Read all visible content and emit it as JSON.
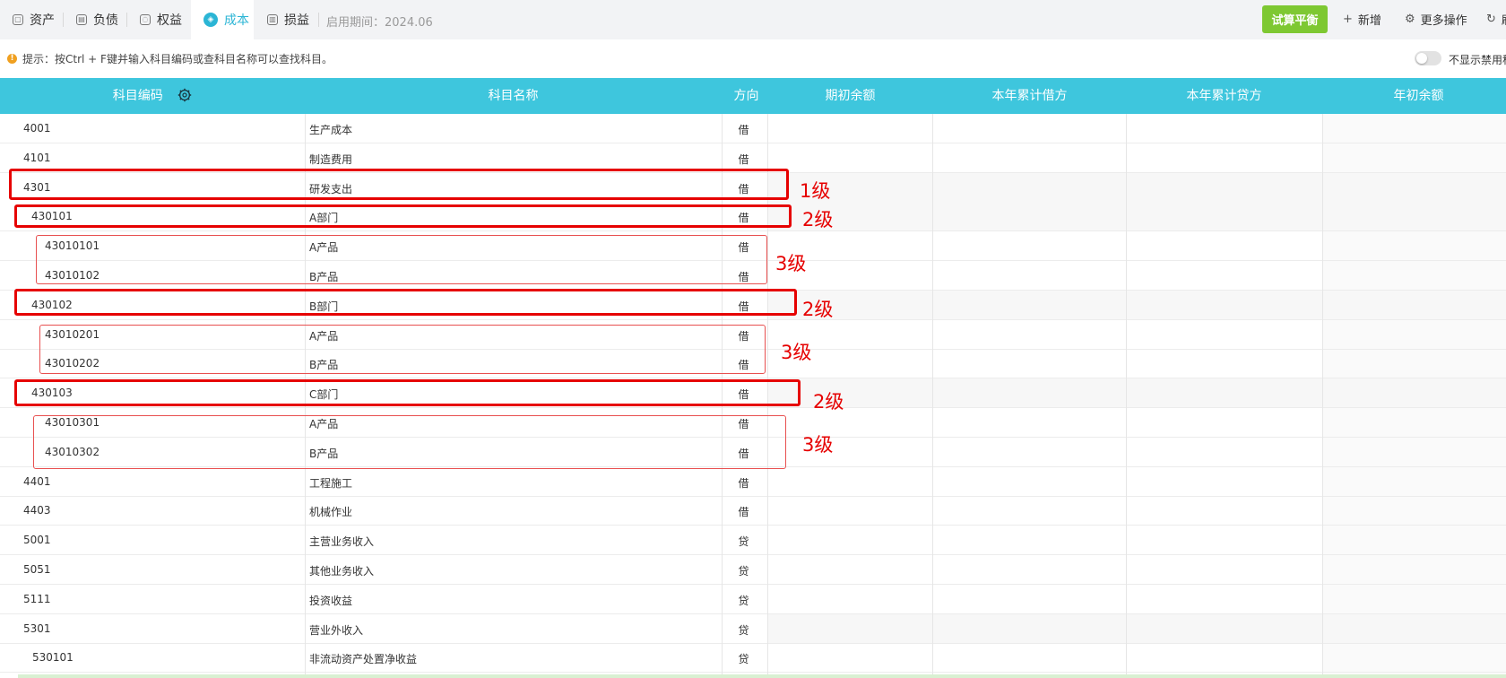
{
  "tabs": [
    {
      "label": "资产",
      "icon": "asset-icon",
      "active": false
    },
    {
      "label": "负债",
      "icon": "liability-icon",
      "active": false
    },
    {
      "label": "权益",
      "icon": "equity-icon",
      "active": false
    },
    {
      "label": "成本",
      "icon": "cost-icon",
      "active": true
    },
    {
      "label": "损益",
      "icon": "profit-loss-icon",
      "active": false
    }
  ],
  "period_label": "启用期间：2024.06",
  "toolbar": {
    "trial_balance": "试算平衡",
    "add": "新增",
    "more": "更多操作",
    "refresh": "刷"
  },
  "hint": {
    "text": "提示：按Ctrl + F键并输入科目编码或查科目名称可以查找科目。"
  },
  "toggle_label": "不显示禁用科目",
  "columns": [
    "科目编码",
    "科目名称",
    "方向",
    "期初余额",
    "本年累计借方",
    "本年累计贷方",
    "年初余额"
  ],
  "rows": [
    {
      "code": "4001",
      "name": "生产成本",
      "dir": "借"
    },
    {
      "code": "4101",
      "name": "制造费用",
      "dir": "借"
    },
    {
      "code": "4301",
      "name": "研发支出",
      "dir": "借"
    },
    {
      "code": "430101",
      "name": "A部门",
      "dir": "借"
    },
    {
      "code": "43010101",
      "name": "A产品",
      "dir": "借"
    },
    {
      "code": "43010102",
      "name": "B产品",
      "dir": "借"
    },
    {
      "code": "430102",
      "name": "B部门",
      "dir": "借"
    },
    {
      "code": "43010201",
      "name": "A产品",
      "dir": "借"
    },
    {
      "code": "43010202",
      "name": "B产品",
      "dir": "借"
    },
    {
      "code": "430103",
      "name": "C部门",
      "dir": "借"
    },
    {
      "code": "43010301",
      "name": "A产品",
      "dir": "借"
    },
    {
      "code": "43010302",
      "name": "B产品",
      "dir": "借"
    },
    {
      "code": "4401",
      "name": "工程施工",
      "dir": "借"
    },
    {
      "code": "4403",
      "name": "机械作业",
      "dir": "借"
    },
    {
      "code": "5001",
      "name": "主营业务收入",
      "dir": "贷"
    },
    {
      "code": "5051",
      "name": "其他业务收入",
      "dir": "贷"
    },
    {
      "code": "5111",
      "name": "投资收益",
      "dir": "贷"
    },
    {
      "code": "5301",
      "name": "营业外收入",
      "dir": "贷"
    },
    {
      "code": "530101",
      "name": "非流动资产处置净收益",
      "dir": "贷"
    }
  ],
  "annotations": {
    "level1": "1级",
    "level2": "2级",
    "level3": "3级"
  },
  "colors": {
    "header_bg": "#3ec6dd",
    "accent": "#2bb5d5",
    "primary_button": "#7ec832",
    "annotation": "#e60000"
  }
}
